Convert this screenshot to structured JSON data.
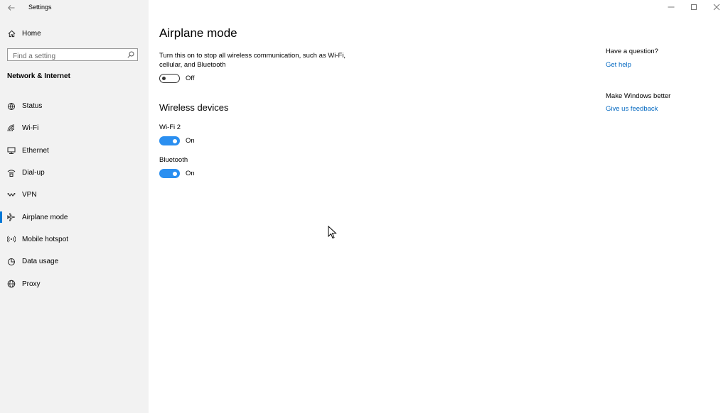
{
  "app": {
    "title": "Settings"
  },
  "sidebar": {
    "home_label": "Home",
    "search": {
      "placeholder": "Find a setting",
      "value": ""
    },
    "section_heading": "Network & Internet",
    "items": [
      {
        "label": "Status",
        "icon": "status-icon"
      },
      {
        "label": "Wi-Fi",
        "icon": "wifi-icon"
      },
      {
        "label": "Ethernet",
        "icon": "ethernet-icon"
      },
      {
        "label": "Dial-up",
        "icon": "dialup-icon"
      },
      {
        "label": "VPN",
        "icon": "vpn-icon"
      },
      {
        "label": "Airplane mode",
        "icon": "airplane-icon",
        "active": true
      },
      {
        "label": "Mobile hotspot",
        "icon": "hotspot-icon"
      },
      {
        "label": "Data usage",
        "icon": "data-usage-icon"
      },
      {
        "label": "Proxy",
        "icon": "proxy-icon"
      }
    ]
  },
  "main": {
    "title": "Airplane mode",
    "description": "Turn this on to stop all wireless communication, such as Wi-Fi, cellular, and Bluetooth",
    "airplane_toggle": {
      "state": "Off"
    },
    "wireless_heading": "Wireless devices",
    "devices": [
      {
        "name": "Wi-Fi 2",
        "state": "On"
      },
      {
        "name": "Bluetooth",
        "state": "On"
      }
    ]
  },
  "right_panel": {
    "question_heading": "Have a question?",
    "help_link": "Get help",
    "better_heading": "Make Windows better",
    "feedback_link": "Give us feedback"
  },
  "colors": {
    "accent": "#0078d7",
    "toggle_on": "#2b8ff0",
    "link": "#0067c0",
    "sidebar_bg": "#f2f2f2"
  }
}
